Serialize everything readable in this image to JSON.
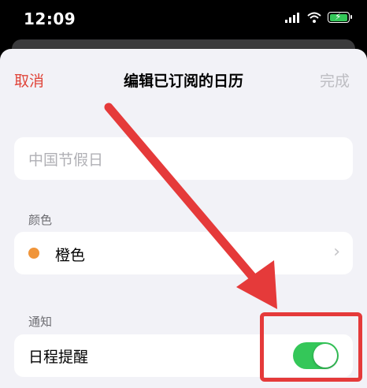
{
  "status_bar": {
    "time": "12:09",
    "icons": [
      "cellular-signal-icon",
      "wifi-icon",
      "battery-charging-icon"
    ],
    "battery_color": "#34c759"
  },
  "nav": {
    "cancel_label": "取消",
    "title": "编辑已订阅的日历",
    "done_label": "完成"
  },
  "calendar_name": {
    "value": "中国节假日"
  },
  "color_section": {
    "header": "颜色",
    "selected_color_name": "橙色",
    "selected_color": "#f0953a"
  },
  "notification_section": {
    "header": "通知",
    "event_alerts_label": "日程提醒",
    "event_alerts_enabled": true,
    "toggle_on_color": "#34c759"
  },
  "annotation": {
    "color": "#e53a3a"
  }
}
